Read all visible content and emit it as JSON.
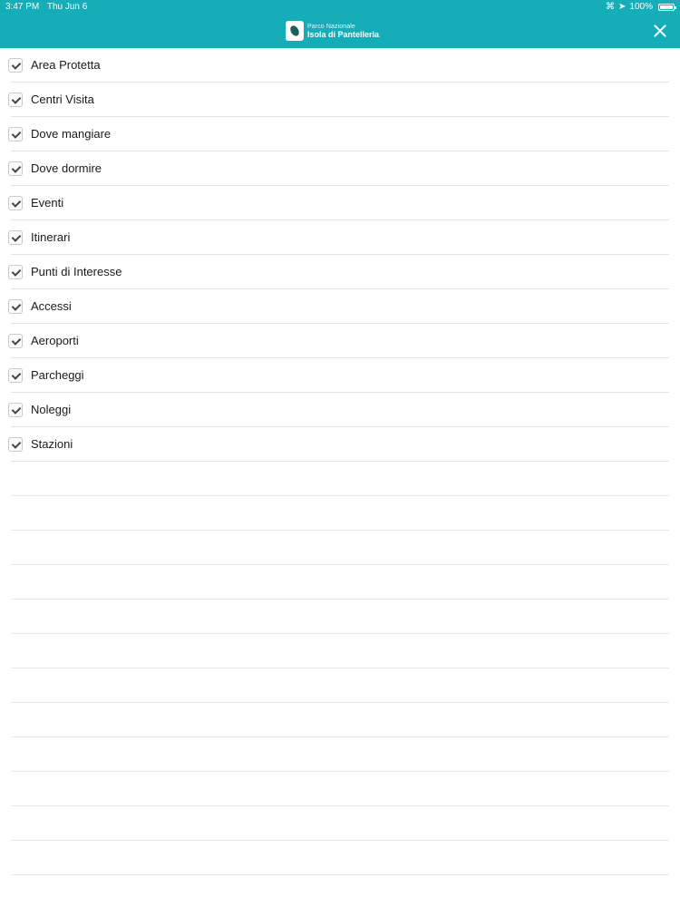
{
  "status_bar": {
    "time": "3:47 PM",
    "date": "Thu Jun 6",
    "battery": "100%"
  },
  "header": {
    "logo_line1": "Parco Nazionale",
    "logo_line2": "Isola di Pantelleria",
    "background_color": "#15adb8"
  },
  "filters": [
    {
      "label": "Area Protetta",
      "checked": true
    },
    {
      "label": "Centri Visita",
      "checked": true
    },
    {
      "label": "Dove mangiare",
      "checked": true
    },
    {
      "label": "Dove dormire",
      "checked": true
    },
    {
      "label": "Eventi",
      "checked": true
    },
    {
      "label": "Itinerari",
      "checked": true
    },
    {
      "label": "Punti di Interesse",
      "checked": true
    },
    {
      "label": "Accessi",
      "checked": true
    },
    {
      "label": "Aeroporti",
      "checked": true
    },
    {
      "label": "Parcheggi",
      "checked": true
    },
    {
      "label": "Noleggi",
      "checked": true
    },
    {
      "label": "Stazioni",
      "checked": true
    }
  ]
}
